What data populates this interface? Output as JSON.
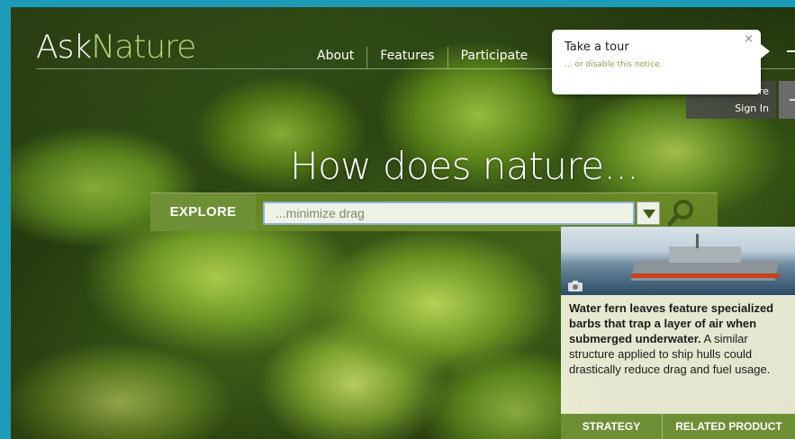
{
  "logo": {
    "ask": "Ask",
    "nature": "Nature"
  },
  "nav": {
    "items": [
      "About",
      "Features",
      "Participate"
    ]
  },
  "tour_popup": {
    "title": "Take a tour",
    "link": "... or disable this notice.",
    "close": "×"
  },
  "account": {
    "line1": "re",
    "sign_in": "Sign In"
  },
  "hero": {
    "headline": "How does nature..."
  },
  "search": {
    "explore_label": "EXPLORE",
    "value": "...minimize drag"
  },
  "feature_card": {
    "bold_text": "Water fern leaves feature specialized barbs that trap a layer of air when submerged underwater.",
    "text": " A similar structure applied to ship hulls could drastically reduce drag and fuel usage.",
    "tabs": [
      "STRATEGY",
      "RELATED PRODUCT"
    ]
  },
  "colors": {
    "accent_green": "#6f8f36",
    "logo_green": "#b6d27b",
    "page_bg": "#1b9bb8"
  },
  "icons": [
    "search-icon",
    "dropdown-arrow-icon",
    "camera-icon",
    "close-icon",
    "plus-icon"
  ]
}
